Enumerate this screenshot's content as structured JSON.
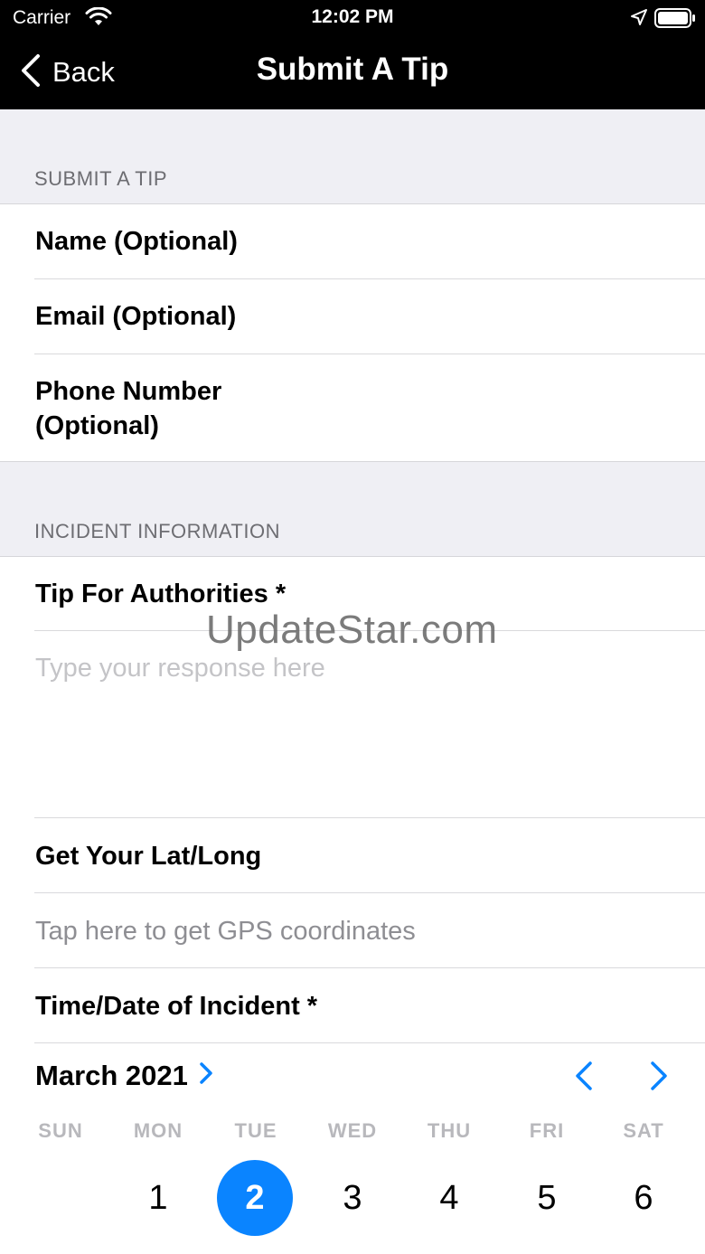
{
  "status_bar": {
    "carrier": "Carrier",
    "time": "12:02 PM"
  },
  "nav": {
    "back_label": "Back",
    "title": "Submit A Tip"
  },
  "sections": {
    "submit_tip_header": "SUBMIT A TIP",
    "incident_header": "INCIDENT INFORMATION"
  },
  "fields": {
    "name_label": "Name (Optional)",
    "email_label": "Email (Optional)",
    "phone_label_line1": "Phone Number",
    "phone_label_line2": "(Optional)",
    "tip_label": "Tip For Authorities *",
    "tip_placeholder": "Type your response here",
    "latlong_label": "Get Your Lat/Long",
    "gps_placeholder": "Tap here to get GPS coordinates",
    "datetime_label": "Time/Date of Incident *"
  },
  "calendar": {
    "month_label": "March 2021",
    "weekdays": [
      "SUN",
      "MON",
      "TUE",
      "WED",
      "THU",
      "FRI",
      "SAT"
    ],
    "days": [
      "1",
      "2",
      "3",
      "4",
      "5",
      "6"
    ],
    "selected_day": "2",
    "accent_color": "#0a84ff"
  },
  "watermark": "UpdateStar.com"
}
